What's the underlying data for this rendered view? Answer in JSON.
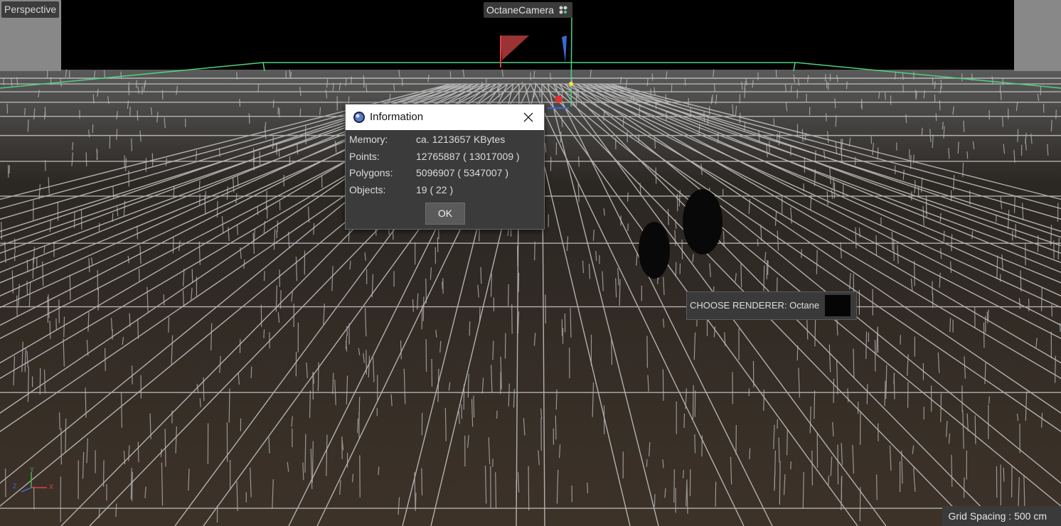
{
  "viewport": {
    "view_name": "Perspective",
    "camera_name": "OctaneCamera",
    "renderer_label": "CHOOSE RENDERER: Octane",
    "grid_spacing": "Grid Spacing : 500 cm",
    "axis_labels": {
      "x": "X",
      "y": "Y",
      "z": "Z"
    }
  },
  "dialog": {
    "title": "Information",
    "close_icon": "close-icon",
    "rows": [
      {
        "label": "Memory:",
        "value": "ca. 1213657 KBytes"
      },
      {
        "label": "Points:",
        "value": "12765887 ( 13017009 )"
      },
      {
        "label": "Polygons:",
        "value": "5096907 ( 5347007 )"
      },
      {
        "label": "Objects:",
        "value": "19 ( 22 )"
      }
    ],
    "ok_label": "OK"
  },
  "colors": {
    "sky": "#000000",
    "ground": "#3a3026",
    "grid": "#c8c8c8",
    "camera_frame": "#4fd080",
    "dialog_bg": "#3b3b3b"
  }
}
